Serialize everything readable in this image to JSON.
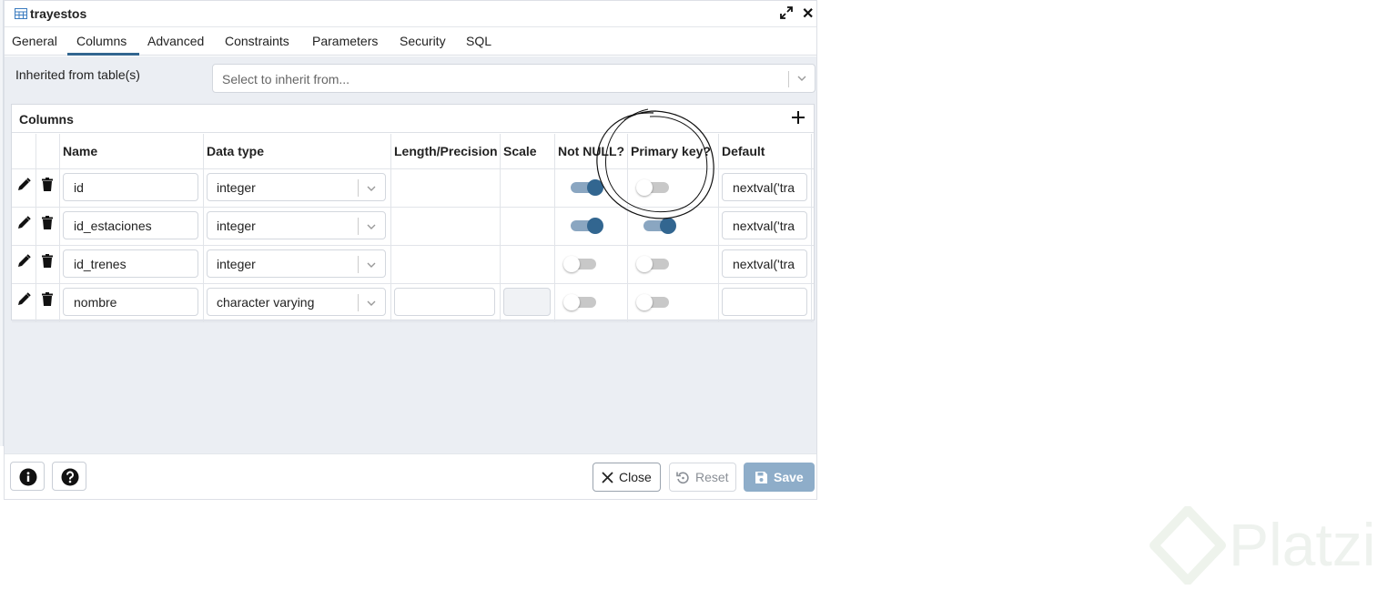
{
  "dialog": {
    "title": "trayestos",
    "tabs": [
      "General",
      "Columns",
      "Advanced",
      "Constraints",
      "Parameters",
      "Security",
      "SQL"
    ],
    "active_tab": "Columns"
  },
  "inherit": {
    "label": "Inherited from table(s)",
    "placeholder": "Select to inherit from..."
  },
  "columns_panel": {
    "title": "Columns",
    "headers": [
      "Name",
      "Data type",
      "Length/Precision",
      "Scale",
      "Not NULL?",
      "Primary key?",
      "Default"
    ],
    "rows": [
      {
        "name": "id",
        "data_type": "integer",
        "length": "",
        "scale": "",
        "not_null": true,
        "primary_key": false,
        "default": "nextval('tra"
      },
      {
        "name": "id_estaciones",
        "data_type": "integer",
        "length": "",
        "scale": "",
        "not_null": true,
        "primary_key": true,
        "default": "nextval('tra"
      },
      {
        "name": "id_trenes",
        "data_type": "integer",
        "length": "",
        "scale": "",
        "not_null": false,
        "primary_key": false,
        "default": "nextval('tra"
      },
      {
        "name": "nombre",
        "data_type": "character varying",
        "length": "",
        "scale": "",
        "not_null": false,
        "primary_key": false,
        "default": ""
      }
    ]
  },
  "footer": {
    "close_label": "Close",
    "reset_label": "Reset",
    "save_label": "Save"
  },
  "colors": {
    "accent": "#326690",
    "toggle_on_track": "#8aa6c1",
    "save_button": "#8eadc9",
    "panel_bg": "#ebeef3"
  },
  "icons": {
    "table": "table-icon",
    "expand": "expand-icon",
    "close": "close-icon",
    "add": "plus-icon",
    "edit": "pencil-icon",
    "delete": "trash-icon",
    "info": "info-icon",
    "help": "help-icon",
    "reset": "reset-icon",
    "save": "floppy-icon"
  },
  "watermark": "Platzi"
}
